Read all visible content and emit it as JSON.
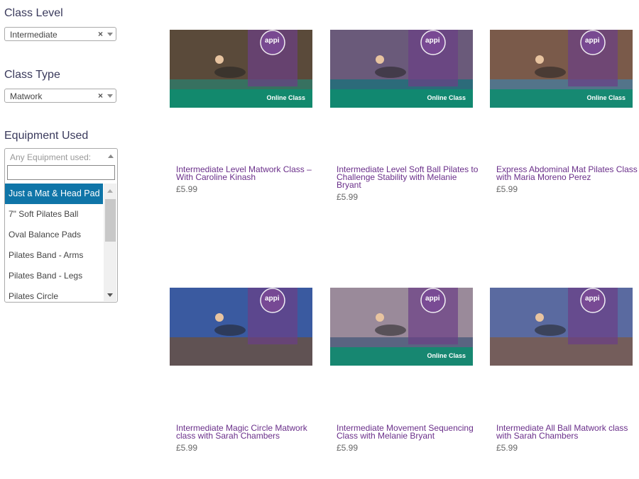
{
  "filters": {
    "class_level": {
      "label": "Class Level",
      "value": "Intermediate"
    },
    "class_type": {
      "label": "Class Type",
      "value": "Matwork"
    },
    "equipment": {
      "label": "Equipment Used",
      "placeholder": "Any Equipment used:",
      "search_value": "",
      "options": [
        "Just a Mat & Head Pad",
        "7\" Soft Pilates Ball",
        "Oval Balance Pads",
        "Pilates Band - Arms",
        "Pilates Band - Legs",
        "Pilates Circle"
      ],
      "highlighted_index": 0
    },
    "clear_glyph": "×"
  },
  "products": [
    {
      "title": "Intermediate Level Matwork Class – With Caroline Kinash",
      "price": "£5.99",
      "badge": "Online Class"
    },
    {
      "title": "Intermediate Level Soft Ball Pilates to Challenge Stability with Melanie Bryant",
      "price": "£5.99",
      "badge": "Online Class"
    },
    {
      "title": "Express Abdominal Mat Pilates Class with Maria Moreno Perez",
      "price": "£5.99",
      "badge": "Online Class"
    },
    {
      "title": "Intermediate Magic Circle Matwork class with Sarah Chambers",
      "price": "£5.99",
      "badge": ""
    },
    {
      "title": "Intermediate Movement Sequencing Class with Melanie Bryant",
      "price": "£5.99",
      "badge": "Online Class"
    },
    {
      "title": "Intermediate All Ball Matwork class with Sarah Chambers",
      "price": "£5.99",
      "badge": ""
    }
  ],
  "brand_logo_text": "appi",
  "colors": {
    "accent": "#0f75a8",
    "title": "#6a2f8a",
    "badge": "#0e8c6e",
    "label": "#3a3a5c"
  }
}
